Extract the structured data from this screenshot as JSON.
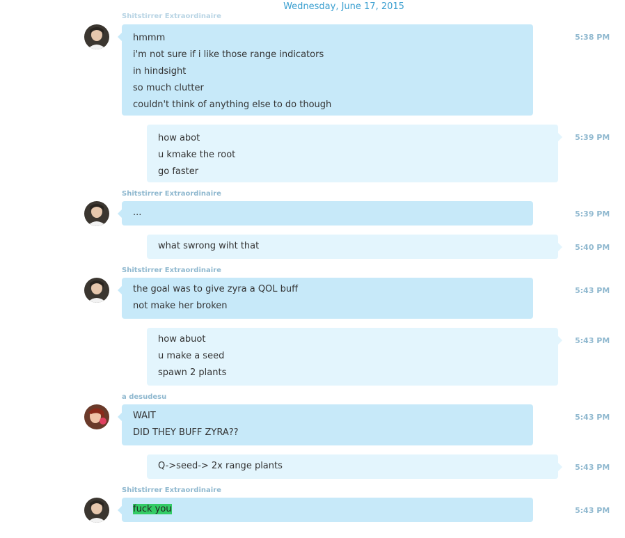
{
  "date_header": "Wednesday, June 17, 2015",
  "top_clipped_name": "Shitstirrer Extraordinaire",
  "messages": [
    {
      "direction": "in",
      "sender": "",
      "lines": [
        "hmmm",
        "i'm not sure if i like those range indicators",
        "in hindsight",
        "so much clutter",
        "couldn't think of anything else to do though"
      ],
      "time": "5:38 PM"
    },
    {
      "direction": "out",
      "lines": [
        "how abot",
        "u kmake the root",
        "go faster"
      ],
      "time": "5:39 PM"
    },
    {
      "direction": "in",
      "sender": "Shitstirrer Extraordinaire",
      "lines": [
        "..."
      ],
      "time": "5:39 PM"
    },
    {
      "direction": "out",
      "lines": [
        "what swrong wiht that"
      ],
      "time": "5:40 PM"
    },
    {
      "direction": "in",
      "sender": "Shitstirrer Extraordinaire",
      "lines": [
        "the goal was to give zyra a QOL buff",
        "not make her broken"
      ],
      "time": "5:43 PM"
    },
    {
      "direction": "out",
      "lines": [
        "how abuot",
        "u make a seed",
        "spawn 2 plants"
      ],
      "time": "5:43 PM"
    },
    {
      "direction": "in",
      "sender": "a desudesu",
      "lines": [
        "WAIT",
        "DID THEY BUFF ZYRA??"
      ],
      "time": "5:43 PM"
    },
    {
      "direction": "out",
      "lines": [
        "Q->seed-> 2x range plants"
      ],
      "time": "5:43 PM"
    },
    {
      "direction": "in",
      "sender": "Shitstirrer Extraordinaire",
      "lines": [
        "fuck you"
      ],
      "highlighted": true,
      "time": "5:43 PM"
    }
  ],
  "colors": {
    "incoming_bubble": "#c7e9f9",
    "outgoing_bubble": "#e3f5fd",
    "timestamp": "#8fb8cf",
    "date": "#3a9fd0",
    "highlight": "#33cc66"
  }
}
